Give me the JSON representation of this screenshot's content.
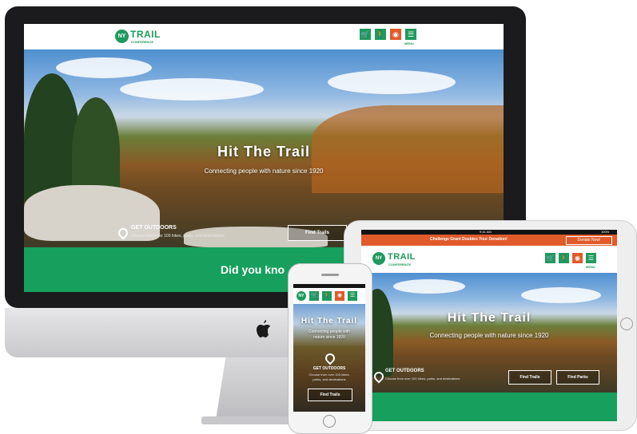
{
  "brand": {
    "logo_mark": "NY",
    "name": "TRAIL",
    "tagline": "CONFERENCE",
    "primary_color": "#1e9a5c",
    "accent_color": "#e05a2a"
  },
  "nav": {
    "icons": [
      "cart-icon",
      "hiker-icon",
      "map-icon",
      "menu-icon"
    ],
    "menu_label": "MENU"
  },
  "hero": {
    "title": "Hit The Trail",
    "subtitle": "Connecting people with nature since 1920"
  },
  "get_outdoors": {
    "title": "GET OUTDOORS",
    "description": "Choose from over 100 hikes, parks, and destinations",
    "find_trails": "Find Trails",
    "find_parks": "Find Parks"
  },
  "did_you_know": "Did you kno",
  "ipad": {
    "status_time": "9:41 AM",
    "status_battery": "100%",
    "banner_text": "Challenge Grant Doubles Your Donation!",
    "donate_button": "Donate Now!"
  },
  "iphone": {
    "hero_title": "Hit The Trail",
    "hero_subtitle_line1": "Connecting people with",
    "hero_subtitle_line2": "nature since 1920",
    "go_title": "GET OUTDOORS",
    "go_line1": "Choose from over 100 hikes,",
    "go_line2": "parks, and destinations",
    "find_trails": "Find Trails"
  }
}
